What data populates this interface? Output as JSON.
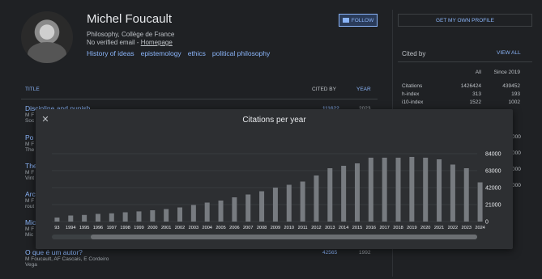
{
  "profile": {
    "name": "Michel Foucault",
    "affiliation": "Philosophy, Collège de France",
    "email_text": "No verified email - ",
    "homepage": "Homepage",
    "tags": [
      "History of ideas",
      "epistemology",
      "ethics",
      "political philosophy"
    ],
    "follow_label": "FOLLOW",
    "profile_button": "GET MY OWN PROFILE"
  },
  "cited_by": {
    "title": "Cited by",
    "view_all": "VIEW ALL",
    "col_all": "All",
    "col_since": "Since 2019",
    "rows": [
      {
        "label": "Citations",
        "all": "1426424",
        "since": "439452"
      },
      {
        "label": "h-index",
        "all": "313",
        "since": "193"
      },
      {
        "label": "i10-index",
        "all": "1522",
        "since": "1002"
      }
    ]
  },
  "articles": {
    "col_title": "TITLE",
    "col_cited": "CITED BY",
    "col_year": "YEAR",
    "items": [
      {
        "title": "Discipline and punish",
        "authors": "M F",
        "venue": "Soc",
        "cited": "111622",
        "year": "2023"
      },
      {
        "title": "Po",
        "authors": "M F",
        "venue": "The",
        "cited": "",
        "year": ""
      },
      {
        "title": "The",
        "authors": "M F",
        "venue": "Vint",
        "cited": "",
        "year": ""
      },
      {
        "title": "Arc",
        "authors": "M F",
        "venue": "rout",
        "cited": "",
        "year": ""
      },
      {
        "title": "Mic",
        "authors": "M F",
        "venue": "Mic",
        "cited": "",
        "year": ""
      },
      {
        "title": "O que é um autor?",
        "authors": "M Foucault, AF Cascais, E Cordeiro",
        "venue": "Vega",
        "cited": "42565",
        "year": "1992"
      }
    ]
  },
  "right_partial_values": [
    "000",
    "000",
    "000",
    "000"
  ],
  "modal": {
    "title": "Citations per year",
    "close_icon": "close-icon"
  },
  "chart_data": {
    "type": "bar",
    "title": "Citations per year",
    "categories": [
      "1993",
      "1994",
      "1995",
      "1996",
      "1997",
      "1998",
      "1999",
      "2000",
      "2001",
      "2002",
      "2003",
      "2004",
      "2005",
      "2006",
      "2007",
      "2008",
      "2009",
      "2010",
      "2011",
      "2012",
      "2013",
      "2014",
      "2015",
      "2016",
      "2017",
      "2018",
      "2019",
      "2020",
      "2021",
      "2022",
      "2023",
      "2024"
    ],
    "tick_labels": [
      "93",
      "1994",
      "1995",
      "1996",
      "1997",
      "1998",
      "1999",
      "2000",
      "2001",
      "2002",
      "2003",
      "2004",
      "2005",
      "2006",
      "2007",
      "2008",
      "2009",
      "2010",
      "2011",
      "2012",
      "2013",
      "2014",
      "2015",
      "2016",
      "2017",
      "2018",
      "2019",
      "2020",
      "2021",
      "2022",
      "2023",
      "2024"
    ],
    "values": [
      5000,
      7500,
      8200,
      9500,
      10200,
      11500,
      12600,
      14000,
      15500,
      17500,
      20500,
      23500,
      26000,
      30000,
      33500,
      37500,
      42000,
      45500,
      49500,
      57000,
      66000,
      69000,
      72000,
      79000,
      79000,
      79000,
      80000,
      79000,
      77000,
      70500,
      66000,
      48500
    ],
    "ylim": [
      0,
      84000
    ],
    "yticks": [
      "0",
      "21000",
      "42000",
      "63000",
      "84000"
    ],
    "grid": true,
    "bar_color": "#777b80"
  }
}
